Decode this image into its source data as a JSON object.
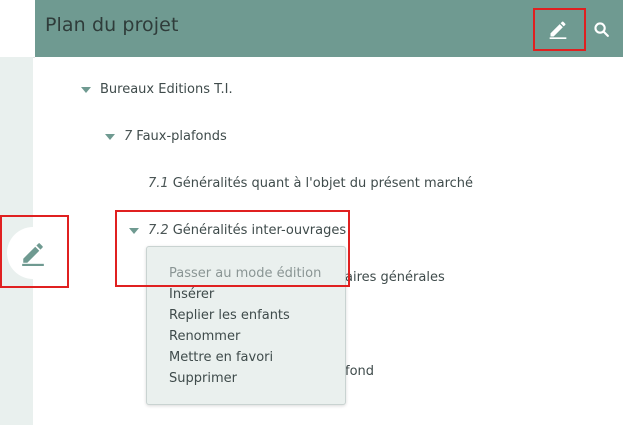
{
  "header": {
    "title": "Plan du projet",
    "edit_icon": "pencil-icon",
    "search_icon": "search-icon",
    "background_color": "#6f9a91"
  },
  "sidebar": {
    "fab_icon": "pencil-icon"
  },
  "tree": {
    "root": {
      "label": "Bureaux Editions T.I."
    },
    "faux_plafonds": {
      "number": "7",
      "label": "Faux-plafonds"
    },
    "generalites_objet": {
      "number": "7.1",
      "label": "Généralités quant à l'objet du présent marché"
    },
    "generalites_inter": {
      "number": "7.2",
      "label": "Généralités inter-ouvrages"
    },
    "partial_1": "aires générales",
    "partial_2": "fond"
  },
  "context_menu": {
    "items": [
      {
        "label": "Passer au mode édition",
        "disabled": true
      },
      {
        "label": "Insérer",
        "disabled": false
      },
      {
        "label": "Replier les enfants",
        "disabled": false
      },
      {
        "label": "Renommer",
        "disabled": false
      },
      {
        "label": "Mettre en favori",
        "disabled": false
      },
      {
        "label": "Supprimer",
        "disabled": false
      }
    ]
  },
  "colors": {
    "accent": "#6f9a91",
    "highlight": "#e02020",
    "sidebar_bg": "#e9f0ee",
    "menu_bg": "#eaf0ee"
  }
}
